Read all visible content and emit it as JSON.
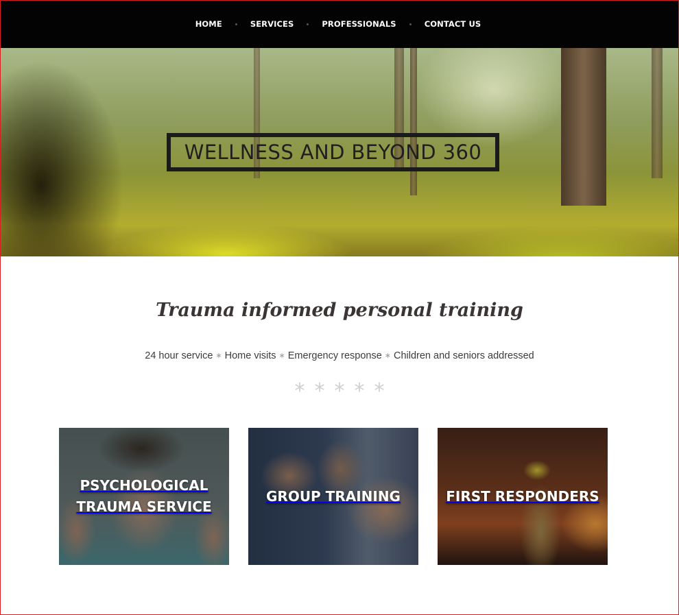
{
  "nav": {
    "items": [
      {
        "label": "HOME"
      },
      {
        "label": "SERVICES"
      },
      {
        "label": "PROFESSIONALS"
      },
      {
        "label": "CONTACT US"
      }
    ]
  },
  "hero": {
    "title": "WELLNESS AND BEYOND 360",
    "background_image": "forest-scene"
  },
  "intro": {
    "tagline": "Trauma informed personal training",
    "features": [
      "24 hour service",
      "Home visits",
      "Emergency response",
      "Children and seniors addressed"
    ],
    "feature_separator": "∗",
    "divider_stars": [
      "*",
      "*",
      "*",
      "*",
      "*"
    ]
  },
  "services": [
    {
      "line1": "PSYCHOLOGICAL",
      "line2": "TRAUMA SERVICE",
      "image": "man-holding-head"
    },
    {
      "line1": "GROUP TRAINING",
      "line2": "",
      "image": "group-holding-hands"
    },
    {
      "line1": "FIRST RESPONDERS",
      "line2": "",
      "image": "firefighter"
    }
  ],
  "colors": {
    "nav_bg": "#030303",
    "nav_text": "#ffffff",
    "title_text": "#1f1f1f",
    "tagline_text": "#3a3434",
    "star_color": "#cfcfcf",
    "frame_border": "#d42020"
  }
}
